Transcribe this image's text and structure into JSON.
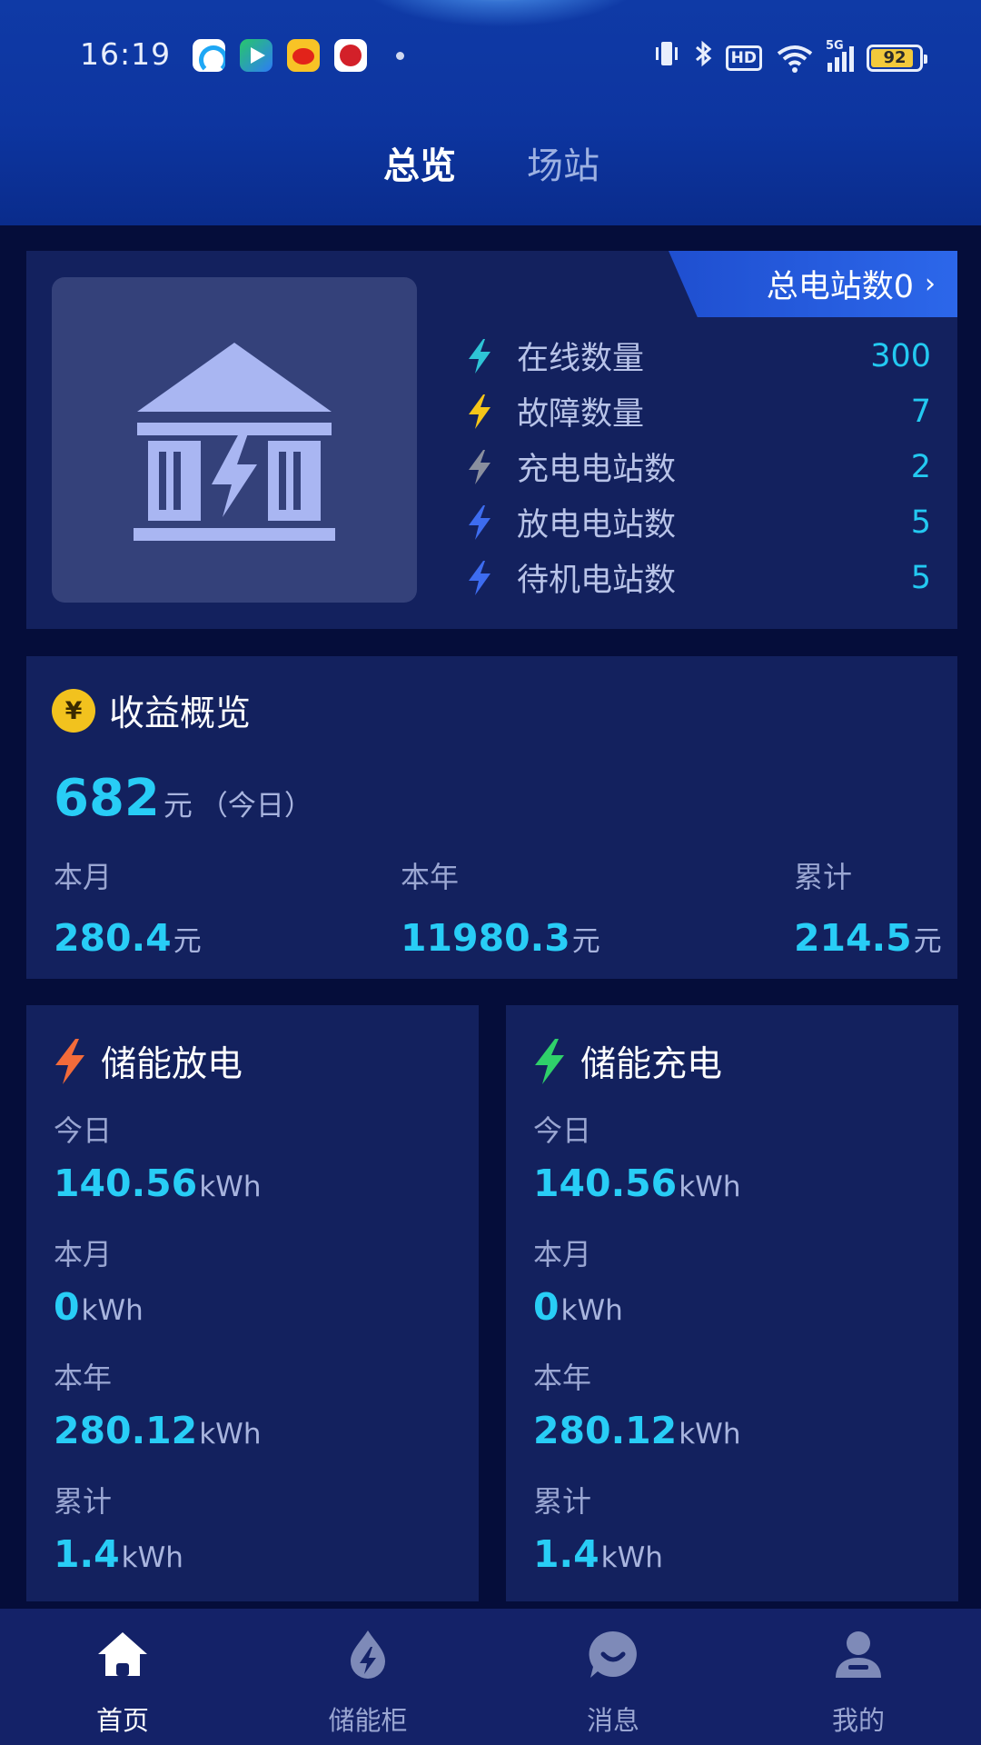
{
  "status_bar": {
    "time": "16:19",
    "battery": "92",
    "network": "5G",
    "hd": "HD"
  },
  "tabs": [
    {
      "label": "总览",
      "active": true
    },
    {
      "label": "场站",
      "active": false
    }
  ],
  "stations": {
    "total_label": "总电站数0",
    "items": [
      {
        "label": "在线数量",
        "value": "300",
        "icon": "bolt-icon",
        "color": "#2ec4d6"
      },
      {
        "label": "故障数量",
        "value": "7",
        "icon": "bolt-icon",
        "color": "#f5c518"
      },
      {
        "label": "充电电站数",
        "value": "2",
        "icon": "bolt-icon",
        "color": "#8a8f9e"
      },
      {
        "label": "放电电站数",
        "value": "5",
        "icon": "bolt-icon",
        "color": "#3d6cf0"
      },
      {
        "label": "待机电站数",
        "value": "5",
        "icon": "bolt-icon",
        "color": "#3d6cf0"
      }
    ]
  },
  "revenue": {
    "title": "收益概览",
    "icon": "yen-icon",
    "icon_symbol": "¥",
    "today_value": "682",
    "today_unit": "元",
    "today_suffix": "（今日）",
    "columns": [
      {
        "label": "本月",
        "value": "280.4",
        "unit": "元"
      },
      {
        "label": "本年",
        "value": "11980.3",
        "unit": "元"
      },
      {
        "label": "累计",
        "value": "214.5",
        "unit": "元"
      }
    ]
  },
  "discharge": {
    "title": "储能放电",
    "icon_color": "#f26b3a",
    "items": [
      {
        "label": "今日",
        "value": "140.56",
        "unit": "kWh"
      },
      {
        "label": "本月",
        "value": "0",
        "unit": "kWh"
      },
      {
        "label": "本年",
        "value": "280.12",
        "unit": "kWh"
      },
      {
        "label": "累计",
        "value": "1.4",
        "unit": "kWh"
      }
    ]
  },
  "charge": {
    "title": "储能充电",
    "icon_color": "#2fd06a",
    "items": [
      {
        "label": "今日",
        "value": "140.56",
        "unit": "kWh"
      },
      {
        "label": "本月",
        "value": "0",
        "unit": "kWh"
      },
      {
        "label": "本年",
        "value": "280.12",
        "unit": "kWh"
      },
      {
        "label": "累计",
        "value": "1.4",
        "unit": "kWh"
      }
    ]
  },
  "nav": [
    {
      "label": "首页",
      "icon": "home-icon",
      "active": true
    },
    {
      "label": "储能柜",
      "icon": "energy-cabinet-icon",
      "active": false
    },
    {
      "label": "消息",
      "icon": "message-icon",
      "active": false
    },
    {
      "label": "我的",
      "icon": "profile-icon",
      "active": false
    }
  ],
  "colors": {
    "background": "#050d3a",
    "card": "#13215e",
    "accent_value": "#28cdf6",
    "header": "#0f3aa6"
  }
}
